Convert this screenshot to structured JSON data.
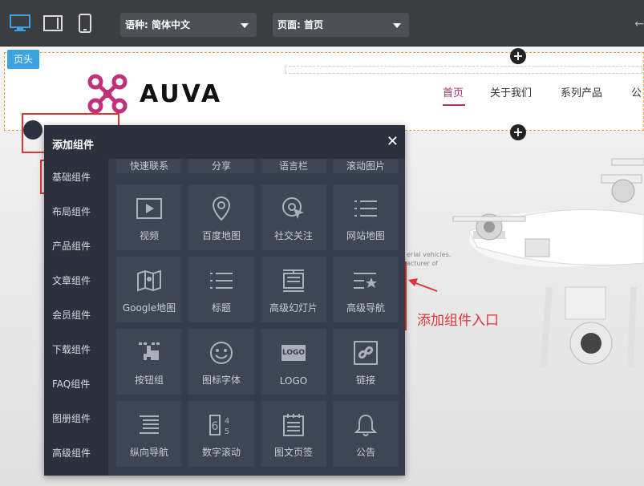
{
  "toolbar": {
    "language_select": "语种: 简体中文",
    "page_select": "页面: 首页",
    "arrow": "←"
  },
  "site": {
    "header_tag": "页头",
    "logo_text": "AUVA",
    "nav": [
      "首页",
      "关于我们",
      "系列产品",
      "公"
    ],
    "faint_line1": "erial vehicles.",
    "faint_line2": "acturer of"
  },
  "panel": {
    "title": "添加组件",
    "close": "✕",
    "categories": [
      "基础组件",
      "布局组件",
      "产品组件",
      "文章组件",
      "会员组件",
      "下载组件",
      "FAQ组件",
      "图册组件",
      "高级组件"
    ],
    "top_row": [
      "快速联系",
      "分享",
      "语言栏",
      "滚动图片"
    ],
    "row1": [
      "视频",
      "百度地图",
      "社交关注",
      "网站地图"
    ],
    "row2": [
      "Google地图",
      "标题",
      "高级幻灯片",
      "高级导航"
    ],
    "row3": [
      "按钮组",
      "图标字体",
      "LOGO",
      "链接"
    ],
    "row4": [
      "纵向导航",
      "数字滚动",
      "图文页签",
      "公告"
    ],
    "logo_icon_text": "LOGO"
  },
  "annotation": {
    "text": "添加组件入口",
    "color": "#e03434"
  },
  "colors": {
    "accent_blue": "#3da2e0",
    "nav_active": "#b0306a",
    "panel_bg": "#2b313d"
  }
}
